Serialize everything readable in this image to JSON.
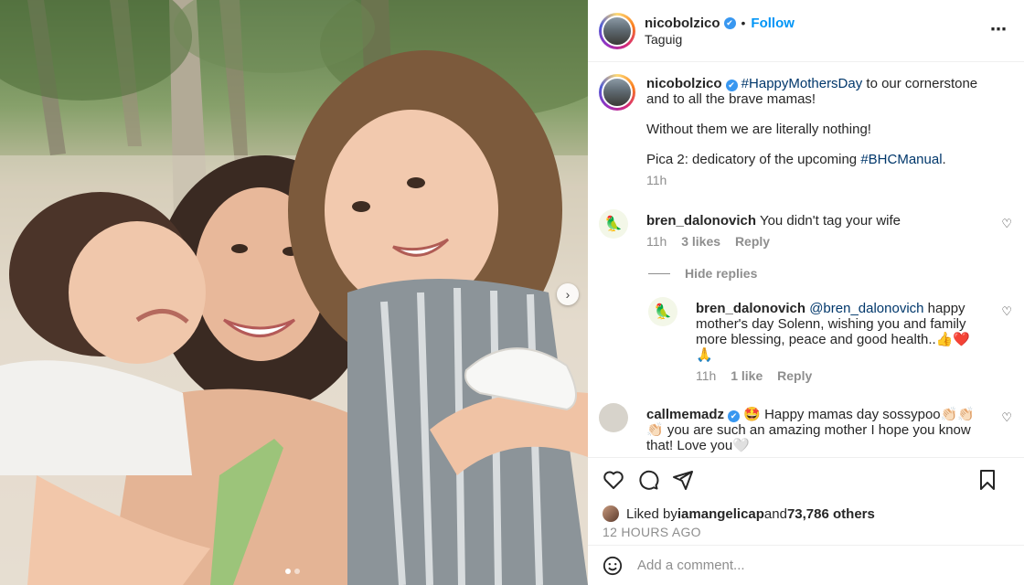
{
  "header": {
    "username": "nicobolzico",
    "verified_mark": "✔",
    "bullet": "•",
    "follow_label": "Follow",
    "location": "Taguig",
    "more_icon": "⋯"
  },
  "caption": {
    "username": "nicobolzico",
    "hashtag1": "#HappyMothersDay",
    "text1": " to our cornerstone and to all the brave mamas!",
    "text2": "Without them we are literally nothing!",
    "text3a": "Pica 2: dedicatory of the upcoming ",
    "hashtag2": "#BHCManual",
    "text3b": ".",
    "time": "11h"
  },
  "comments": [
    {
      "username": "bren_dalonovich",
      "text": "You didn't tag your wife",
      "time": "11h",
      "likes": "3 likes",
      "reply_label": "Reply",
      "avatar_emoji": "🦜"
    },
    {
      "username": "bren_dalonovich",
      "mention": "@bren_dalonovich",
      "text": " happy mother's day Solenn, wishing you and family more blessing, peace and good health..👍❤️ 🙏",
      "time": "11h",
      "likes": "1 like",
      "reply_label": "Reply",
      "avatar_emoji": "🦜"
    },
    {
      "username": "callmemadz",
      "text": "🤩 Happy mamas day sossypoo👏🏻👏🏻👏🏻 you are such an amazing mother I hope you know that! Love you🤍"
    }
  ],
  "hide_replies_label": "Hide replies",
  "likes": {
    "prefix": "Liked by ",
    "user": "iamangelicap",
    "middle": " and ",
    "count": "73,786 others"
  },
  "post_time": "12 HOURS AGO",
  "add_comment_placeholder": "Add a comment...",
  "icons": {
    "heart": "heart-icon",
    "comment": "comment-icon",
    "share": "share-icon",
    "bookmark": "bookmark-icon",
    "emoji": "emoji-icon",
    "next": "chevron-right-icon"
  },
  "colors": {
    "link": "#00376b",
    "follow": "#0095f6",
    "verified": "#3897f0",
    "muted": "#8e8e8e"
  }
}
